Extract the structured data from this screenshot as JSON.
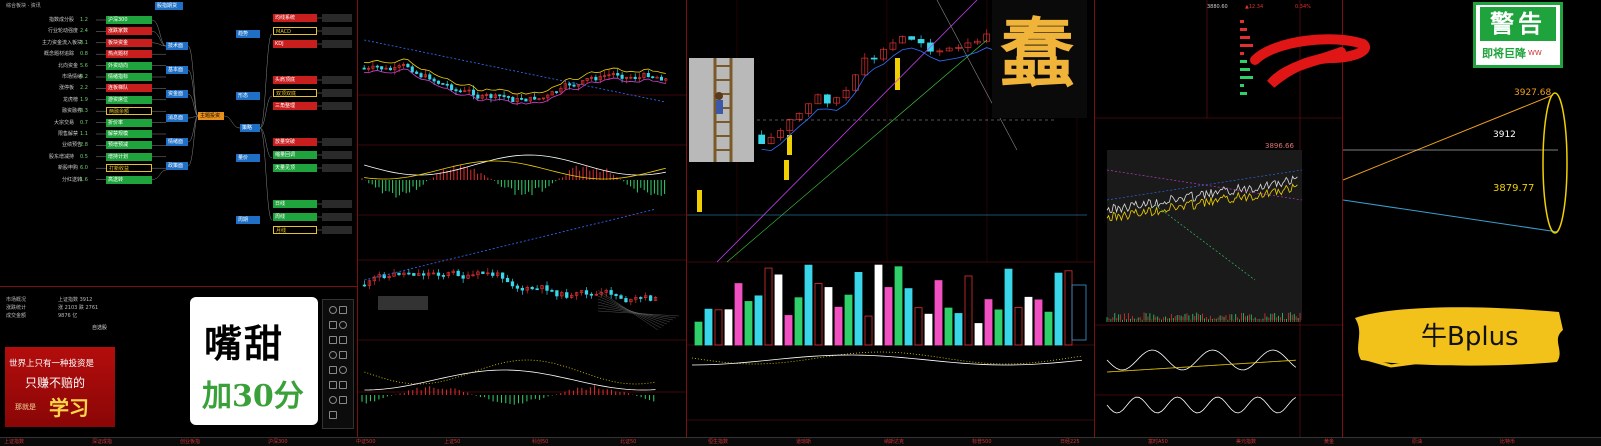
{
  "mindmap": {
    "top_label": "综合板块 · 资讯",
    "top_button": "股指期货",
    "center_node": "主题投资",
    "hub_node": "策略",
    "left_items": [
      {
        "label": "指数成分股",
        "value": "1.2",
        "tag": "green",
        "tag_label": "沪深300"
      },
      {
        "label": "行业轮动强度",
        "value": "2.4",
        "tag": "red",
        "tag_label": "涨跌家数"
      },
      {
        "label": "主力资金流入板块",
        "value": "3.1",
        "tag": "red",
        "tag_label": "板块资金"
      },
      {
        "label": "概念题材追踪",
        "value": "0.8",
        "tag": "red",
        "tag_label": "热点题材"
      },
      {
        "label": "北向资金",
        "value": "5.6",
        "tag": "green",
        "tag_label": "外资动向"
      },
      {
        "label": "市场情绪",
        "value": "4.2",
        "tag": "green",
        "tag_label": "情绪指标"
      },
      {
        "label": "涨停板",
        "value": "2.2",
        "tag": "red",
        "tag_label": "连板梯队"
      },
      {
        "label": "龙虎榜",
        "value": "1.9",
        "tag": "green",
        "tag_label": "游资席位"
      },
      {
        "label": "融资融券",
        "value": "3.3",
        "tag": "yellow",
        "tag_label": "两融余额"
      },
      {
        "label": "大宗交易",
        "value": "0.7",
        "tag": "green",
        "tag_label": "折价率"
      },
      {
        "label": "限售解禁",
        "value": "1.1",
        "tag": "green",
        "tag_label": "解禁规模"
      },
      {
        "label": "业绩预告",
        "value": "2.8",
        "tag": "green",
        "tag_label": "预增预减"
      },
      {
        "label": "股东增减持",
        "value": "0.5",
        "tag": "green",
        "tag_label": "增持计划"
      },
      {
        "label": "新股申购",
        "value": "6.0",
        "tag": "yellow",
        "tag_label": "打新收益"
      },
      {
        "label": "分红送转",
        "value": "1.6",
        "tag": "green",
        "tag_label": "高送转"
      }
    ],
    "mid_blue": [
      "技术面",
      "基本面",
      "资金面",
      "消息面",
      "情绪面",
      "政策面"
    ],
    "right_groups": [
      {
        "head": "趋势",
        "items": [
          {
            "label": "均线系统",
            "tag": "red"
          },
          {
            "label": "MACD",
            "tag": "yellow"
          },
          {
            "label": "KDJ",
            "tag": "red"
          }
        ]
      },
      {
        "head": "形态",
        "items": [
          {
            "label": "头肩顶底",
            "tag": "red"
          },
          {
            "label": "双顶双底",
            "tag": "yellow"
          },
          {
            "label": "三角整理",
            "tag": "red"
          }
        ]
      },
      {
        "head": "量价",
        "items": [
          {
            "label": "放量突破",
            "tag": "red"
          },
          {
            "label": "缩量回调",
            "tag": "green"
          },
          {
            "label": "天量见顶",
            "tag": "green"
          }
        ]
      },
      {
        "head": "周期",
        "items": [
          {
            "label": "日线",
            "tag": "green"
          },
          {
            "label": "周线",
            "tag": "green"
          },
          {
            "label": "月线",
            "tag": "yellow"
          }
        ]
      }
    ]
  },
  "info_panel": {
    "rows": [
      {
        "left": "市场概况",
        "right": "上证指数 3912"
      },
      {
        "left": "涨跌统计",
        "right": "涨 2103 跌 2761"
      },
      {
        "left": "成交金额",
        "right": "9876 亿"
      }
    ],
    "sub_label": "自选股"
  },
  "banner": {
    "line1": "世界上只有一种投资是",
    "line2": "只赚不赔的",
    "line3a": "那就是",
    "line3b": "学习"
  },
  "sticker_sweet": {
    "line1": "嘴甜",
    "line2": "加30分"
  },
  "sticker_warning": {
    "title": "警告",
    "sub": "即将巨降",
    "tail": "WW"
  },
  "sticker_bull": {
    "text": "牛Bplus"
  },
  "sticker_character": "蠢",
  "price_header": {
    "code": "3880.60",
    "change": "▲12.34",
    "pct": "0.34%"
  },
  "chart_right": {
    "levels": [
      "3927.68",
      "3912",
      "3879.77"
    ]
  },
  "chart_mid": {
    "price_label": "3896.66"
  },
  "bottom_tabs": [
    "上证指数",
    "深证成指",
    "创业板指",
    "沪深300",
    "中证500",
    "上证50",
    "科创50",
    "北证50",
    "恒生指数",
    "道琼斯",
    "纳斯达克",
    "标普500",
    "日经225",
    "富时A50",
    "美元指数",
    "黄金",
    "原油",
    "比特币"
  ],
  "colors": {
    "bg": "#000000",
    "grid_red": "#7a1010",
    "up": "#e03030",
    "down": "#38d6e8",
    "accent_green": "#1fa33c",
    "accent_yellow": "#f0d000"
  }
}
